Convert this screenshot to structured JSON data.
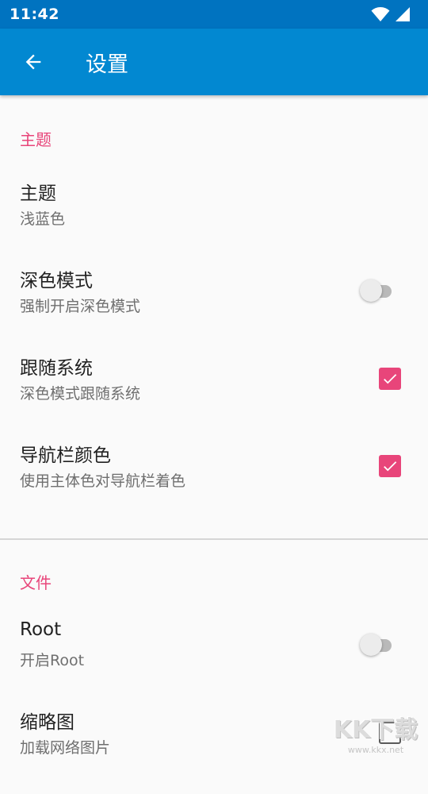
{
  "status_bar": {
    "time": "11:42",
    "icons": [
      "wifi-icon",
      "cell-signal-icon"
    ]
  },
  "app_bar": {
    "back_icon": "arrow-back-icon",
    "title": "设置"
  },
  "colors": {
    "status_bar": "#0073c0",
    "app_bar": "#0288d1",
    "accent": "#e8457a",
    "background": "#fafafa"
  },
  "sections": [
    {
      "header": "主题",
      "items": [
        {
          "title": "主题",
          "summary": "浅蓝色",
          "widget": "none"
        },
        {
          "title": "深色模式",
          "summary": "强制开启深色模式",
          "widget": "switch",
          "checked": false
        },
        {
          "title": "跟随系统",
          "summary": "深色模式跟随系统",
          "widget": "checkbox",
          "checked": true
        },
        {
          "title": "导航栏颜色",
          "summary": "使用主体色对导航栏着色",
          "widget": "checkbox",
          "checked": true
        }
      ]
    },
    {
      "header": "文件",
      "items": [
        {
          "title": "Root",
          "summary": "开启Root",
          "widget": "switch",
          "checked": false
        },
        {
          "title": "缩略图",
          "summary": "加载网络图片",
          "widget": "checkbox",
          "checked": false
        }
      ]
    }
  ],
  "watermark": {
    "logo": "KK下载",
    "url": "www.kkx.net"
  }
}
